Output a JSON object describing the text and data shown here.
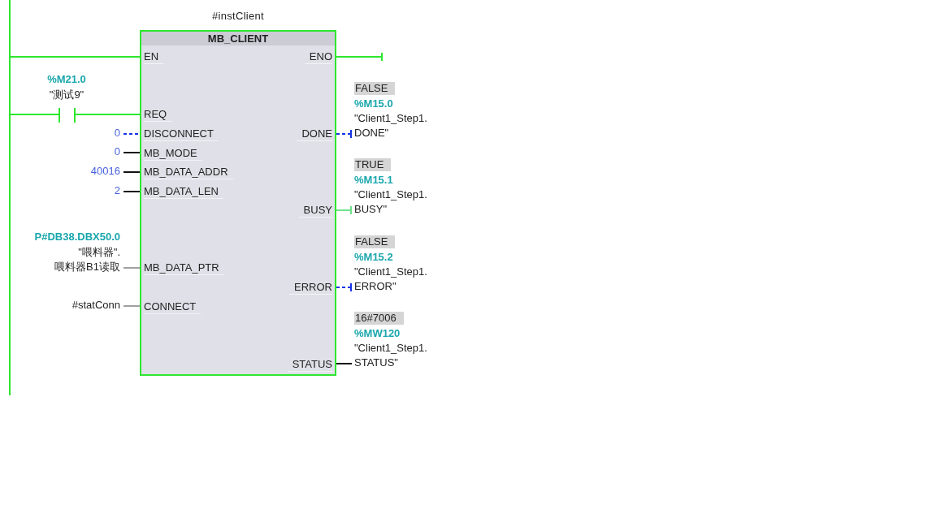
{
  "block": {
    "instance": "#instClient",
    "type": "MB_CLIENT",
    "enabled": true,
    "en": "EN",
    "eno": "ENO"
  },
  "contact": {
    "address": "%M21.0",
    "symbol": "\"测试9\"",
    "closed": true,
    "pin": "REQ"
  },
  "inputs": [
    {
      "pin": "DISCONNECT",
      "kind": "bool",
      "on": false,
      "value": "0"
    },
    {
      "pin": "MB_MODE",
      "kind": "constant",
      "value": "0"
    },
    {
      "pin": "MB_DATA_ADDR",
      "kind": "constant",
      "value": "40016"
    },
    {
      "pin": "MB_DATA_LEN",
      "kind": "constant",
      "value": "2"
    },
    {
      "pin": "MB_DATA_PTR",
      "kind": "tag",
      "address": "P#DB38.DBX50.0",
      "symbol_lines": [
        "\"喂料器\".",
        "喂料器B1读取"
      ]
    },
    {
      "pin": "CONNECT",
      "kind": "tag",
      "symbol_lines": [
        "#statConn"
      ]
    }
  ],
  "outputs": [
    {
      "pin": "DONE",
      "kind": "bool",
      "on": false,
      "value": "FALSE",
      "address": "%M15.0",
      "symbol_lines": [
        "\"Client1_Step1.",
        "DONE\""
      ]
    },
    {
      "pin": "BUSY",
      "kind": "bool",
      "on": true,
      "value": "TRUE",
      "address": "%M15.1",
      "symbol_lines": [
        "\"Client1_Step1.",
        "BUSY\""
      ]
    },
    {
      "pin": "ERROR",
      "kind": "bool",
      "on": false,
      "value": "FALSE",
      "address": "%M15.2",
      "symbol_lines": [
        "\"Client1_Step1.",
        "ERROR\""
      ]
    },
    {
      "pin": "STATUS",
      "kind": "word",
      "value": "16#7006",
      "address": "%MW120",
      "symbol_lines": [
        "\"Client1_Step1.",
        "STATUS\""
      ]
    }
  ]
}
